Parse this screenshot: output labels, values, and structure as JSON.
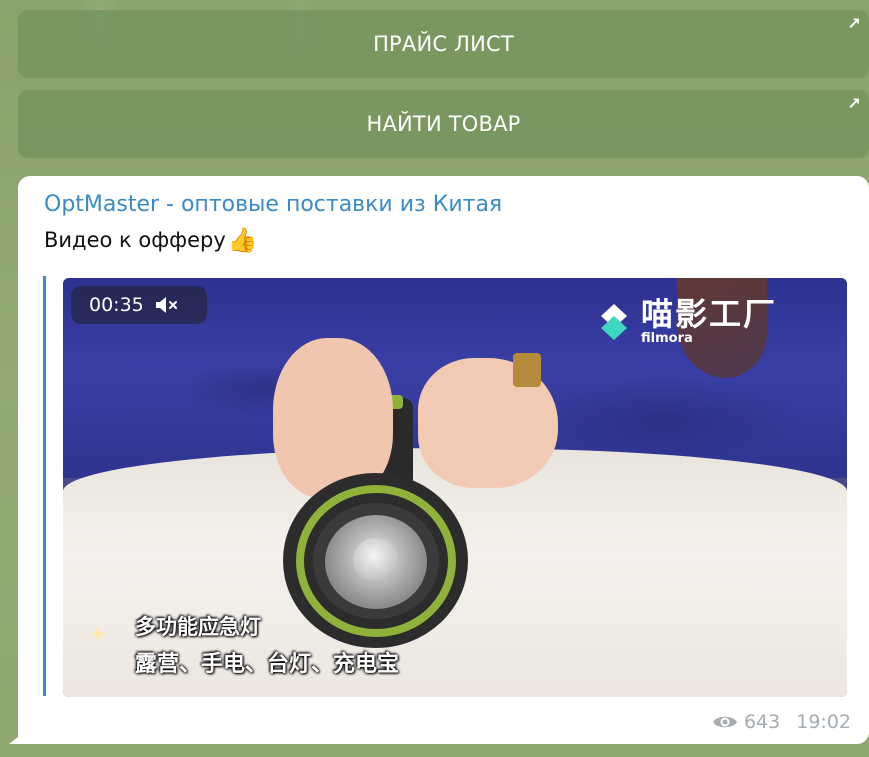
{
  "keyboard": {
    "buttons": [
      {
        "label": "ПРАЙС ЛИСТ",
        "icon": "arrow-up-right-icon"
      },
      {
        "label": "НАЙТИ ТОВАР",
        "icon": "arrow-up-right-icon"
      }
    ]
  },
  "message": {
    "sender": "OptMaster - оптовые поставки из Китая",
    "caption": "Видео к офферу",
    "caption_emoji": "👍",
    "video": {
      "duration": "00:35",
      "muted_icon": "speaker-muted-icon",
      "watermark_main": "喵影工厂",
      "watermark_sub": "filmora",
      "subtitle_line1": "多功能应急灯",
      "subtitle_line2": "露营、手电、台灯、充电宝"
    },
    "views": "643",
    "time": "19:02"
  },
  "colors": {
    "accent": "#3a8cc6",
    "button_bg": "#7a9860",
    "chat_bg": "#8fa66c",
    "meta": "#a5acb2"
  }
}
